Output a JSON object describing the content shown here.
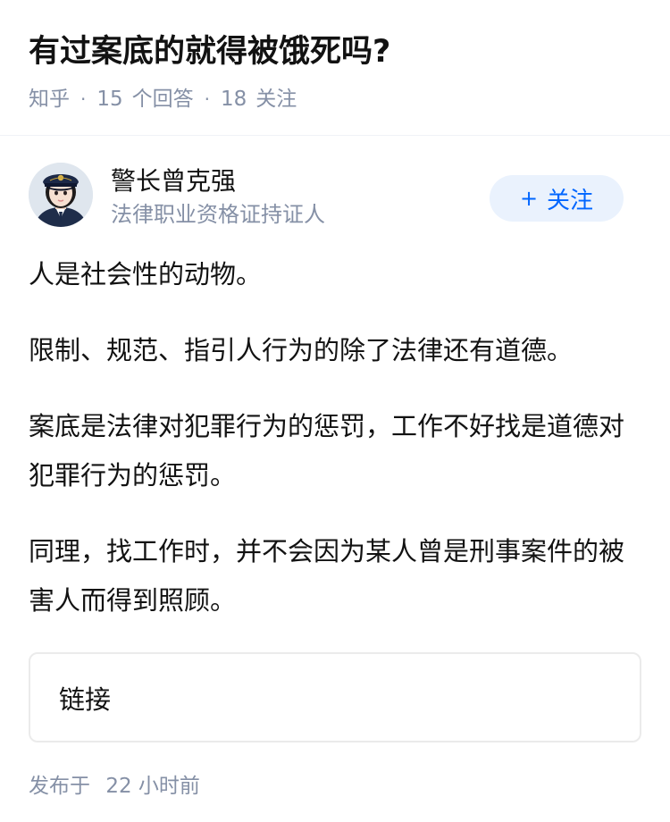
{
  "question": {
    "title": "有过案底的就得被饿死吗?",
    "source": "知乎",
    "separator": "·",
    "answers_count": "15",
    "answers_label": "个回答",
    "followers_count": "18",
    "followers_label": "关注"
  },
  "author": {
    "name": "警长曾克强",
    "badge": "法律职业资格证持证人",
    "avatar_icon": "police-avatar-icon"
  },
  "follow_button": {
    "icon": "+",
    "label": "关注"
  },
  "content": {
    "paragraphs": [
      "人是社会性的动物。",
      "限制、规范、指引人行为的除了法律还有道德。",
      "案底是法律对犯罪行为的惩罚，工作不好找是道德对犯罪行为的惩罚。",
      "同理，找工作时，并不会因为某人曾是刑事案件的被害人而得到照顾。"
    ]
  },
  "link_card": {
    "label": "链接"
  },
  "footer": {
    "publish_prefix": "发布于",
    "publish_time": "22 小时前"
  },
  "colors": {
    "accent": "#0066ff",
    "follow_bg": "#eaf2fd",
    "meta": "#8590a6",
    "text": "#121212"
  }
}
